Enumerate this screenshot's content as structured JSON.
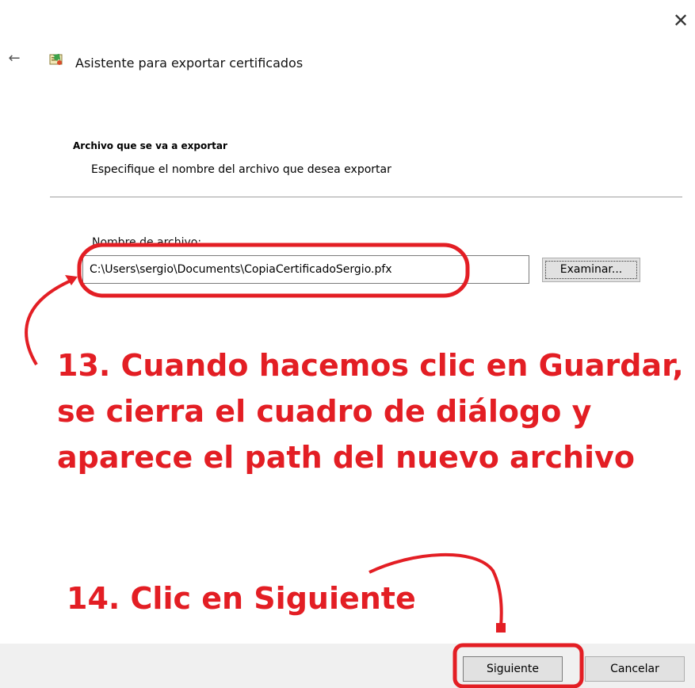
{
  "window": {
    "title": "Asistente para exportar certificados",
    "close_icon": "close-icon",
    "back_icon": "back-arrow-icon",
    "wizard_icon": "certificate-icon"
  },
  "section": {
    "title": "Archivo que se va a exportar",
    "description": "Especifique el nombre del archivo que desea exportar"
  },
  "form": {
    "filename_label": "Nombre de archivo:",
    "filename_value": "C:\\Users\\sergio\\Documents\\CopiaCertificadoSergio.pfx",
    "browse_label": "Examinar..."
  },
  "annotations": {
    "step13": "13. Cuando hacemos clic en Guardar, se cierra el cuadro de diálogo y aparece el path del nuevo archivo",
    "step14": "14. Clic en Siguiente",
    "color": "#e31e24"
  },
  "footer": {
    "next_label": "Siguiente",
    "cancel_label": "Cancelar"
  }
}
